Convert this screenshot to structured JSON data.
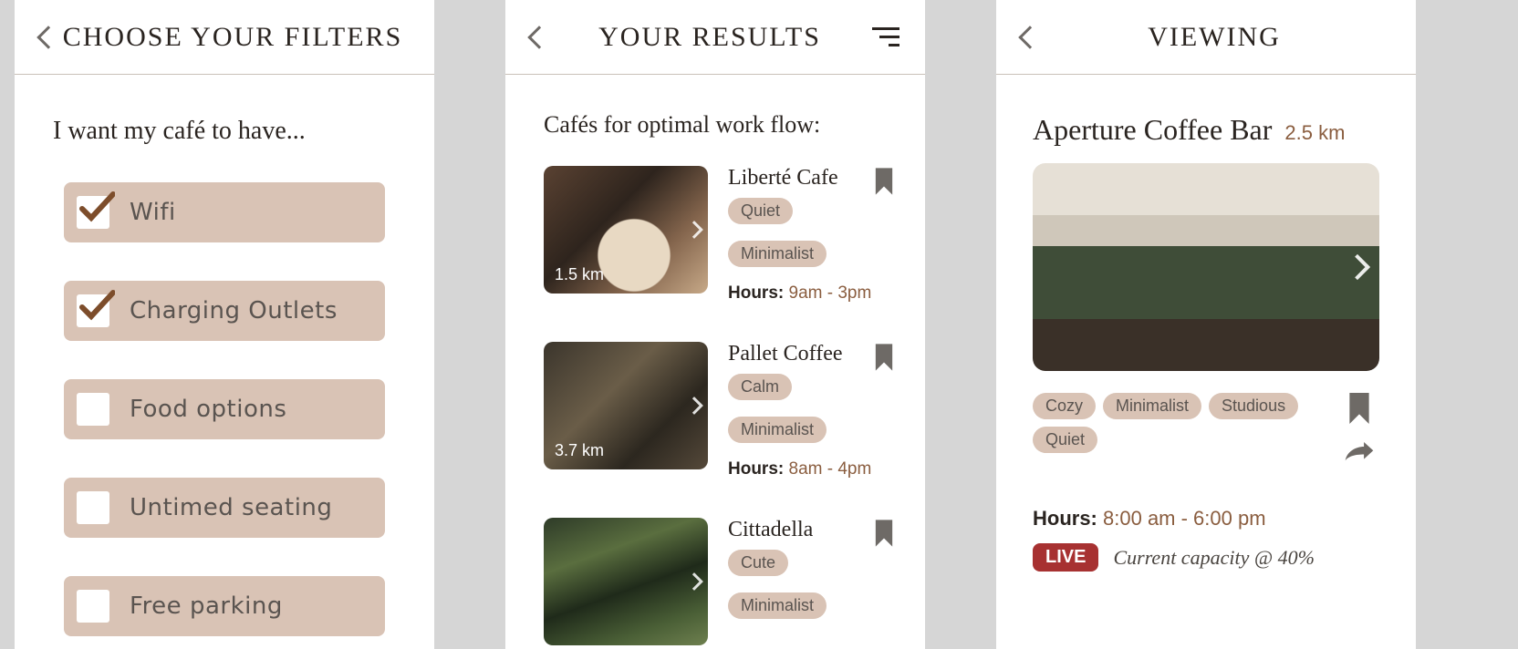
{
  "screen1": {
    "title": "CHOOSE YOUR FILTERS",
    "prompt": "I want my café to have...",
    "filters": [
      {
        "label": "Wifi",
        "checked": true
      },
      {
        "label": "Charging Outlets",
        "checked": true
      },
      {
        "label": "Food options",
        "checked": false
      },
      {
        "label": "Untimed seating",
        "checked": false
      },
      {
        "label": "Free parking",
        "checked": false
      }
    ]
  },
  "screen2": {
    "title": "YOUR RESULTS",
    "heading": "Cafés for optimal work flow:",
    "hours_label": "Hours:",
    "results": [
      {
        "name": "Liberté Cafe",
        "distance": "1.5 km",
        "tags": [
          "Quiet",
          "Minimalist"
        ],
        "hours": "9am - 3pm",
        "image": "latte"
      },
      {
        "name": "Pallet Coffee",
        "distance": "3.7 km",
        "tags": [
          "Calm",
          "Minimalist"
        ],
        "hours": "8am - 4pm",
        "image": "industrial"
      },
      {
        "name": "Cittadella",
        "distance": "",
        "tags": [
          "Cute",
          "Minimalist"
        ],
        "hours": "",
        "image": "greenhouse"
      }
    ]
  },
  "screen3": {
    "title": "VIEWING",
    "cafe_name": "Aperture Coffee Bar",
    "distance": "2.5 km",
    "tags": [
      "Cozy",
      "Minimalist",
      "Studious",
      "Quiet"
    ],
    "hours_label": "Hours:",
    "hours": "8:00 am - 6:00 pm",
    "live_label": "LIVE",
    "live_text": "Current capacity @ 40%"
  }
}
